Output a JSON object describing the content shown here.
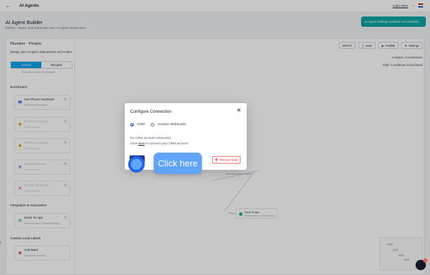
{
  "app": {
    "title": "AI Agents"
  },
  "topbar": {
    "learn_more": "Learn More"
  },
  "header": {
    "title": "AI Agent Builder",
    "subtitle": "Define, create, and automate your AI Agent sequences"
  },
  "toast": {
    "text": "AI Agent settings updated successfully"
  },
  "sidebar": {
    "flow_name": "Plumber - People",
    "description": "Design your AI Agent using actions and recipes",
    "tabs": [
      "Actions",
      "Recipes"
    ],
    "partial_text": "Generate custom AI message",
    "sections": {
      "enrichment": "Enrichment",
      "integration": "Integration & Automation",
      "labels": "Custom Lead Labels"
    },
    "enrichment_items": [
      {
        "title": "Get Phone Numbers",
        "subtitle": "Get Phone Numbers",
        "badge": "3"
      },
      {
        "title": "Enrich Company",
        "subtitle": "Enrich results",
        "badge": "3"
      },
      {
        "title": "Enrich Company",
        "subtitle": "Enrich results",
        "badge": "3"
      },
      {
        "title": "Enrich Domain",
        "subtitle": "Enrich results",
        "badge": "3"
      },
      {
        "title": "Enrich Influencer",
        "subtitle": "Enrich results",
        "badge": "3"
      }
    ],
    "integration_items": [
      {
        "title": "Send To App",
        "subtitle": "Send results to Connected App",
        "badge": "3"
      }
    ],
    "label_items": [
      {
        "title": "Add label",
        "subtitle": "Add labels to leads",
        "badge": ""
      }
    ]
  },
  "canvas": {
    "toolbar": {
      "draft": "DRAFT",
      "save": "Save",
      "publish": "Publish",
      "settings": "Settings"
    },
    "stats": {
      "actions": "4 actions, 3 connections",
      "credits": "Total: 3 credits per record found"
    },
    "node": {
      "title": "Send To App",
      "subtitle": "Send results to Connected App"
    },
    "node_partial": "Generate custom message"
  },
  "modal": {
    "title": "Configure Connection",
    "options": [
      "CRM",
      "Custom Webhooks"
    ],
    "selected": "CRM",
    "line1": "No CRM account connected.",
    "line2_prefix": "Click",
    "link": "here",
    "line2_suffix": "to connect your CRM account.",
    "remove_label": "Remove Node"
  },
  "tooltip": {
    "text": "Click here"
  },
  "colors": {
    "accent": "#0ea5e9",
    "toast": "#0ea5a4",
    "danger": "#dc2626"
  }
}
